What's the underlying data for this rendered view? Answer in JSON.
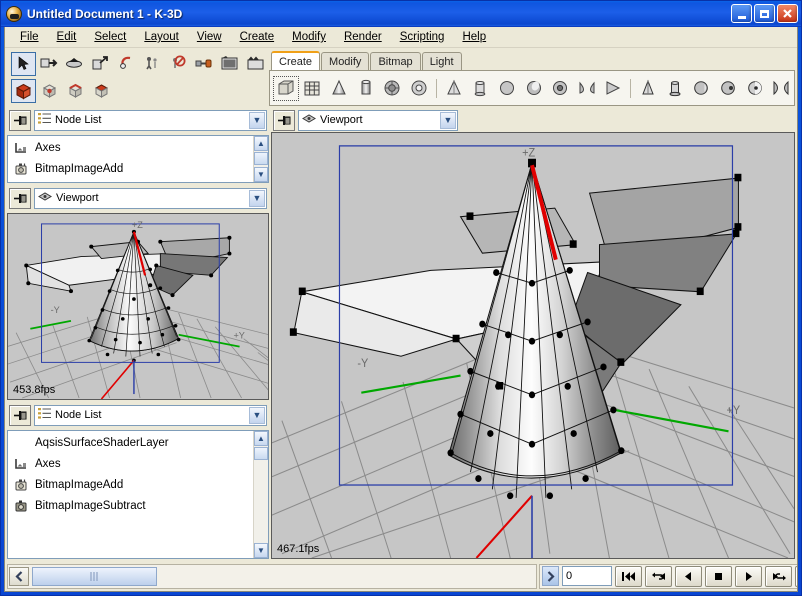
{
  "window": {
    "title": "Untitled Document 1 - K-3D",
    "icon": "k3d-app-icon",
    "buttons": {
      "minimize": "minimize",
      "maximize": "maximize",
      "close": "close"
    }
  },
  "menu": [
    {
      "label": "File",
      "accel": "F"
    },
    {
      "label": "Edit",
      "accel": "E"
    },
    {
      "label": "Select",
      "accel": "S"
    },
    {
      "label": "Layout",
      "accel": "L"
    },
    {
      "label": "View",
      "accel": "V"
    },
    {
      "label": "Create",
      "accel": "C"
    },
    {
      "label": "Modify",
      "accel": "M"
    },
    {
      "label": "Render",
      "accel": "R"
    },
    {
      "label": "Scripting",
      "accel": "p"
    },
    {
      "label": "Help",
      "accel": "H"
    }
  ],
  "toolbar_main": {
    "row1": [
      {
        "name": "select-tool",
        "selected": true
      },
      {
        "name": "move-tool",
        "selected": false
      },
      {
        "name": "rotate-tool",
        "selected": false
      },
      {
        "name": "scale-tool",
        "selected": false
      },
      {
        "name": "snap-tool",
        "selected": false
      },
      {
        "name": "parent-tool",
        "selected": false
      },
      {
        "name": "unparent-tool",
        "selected": false
      },
      {
        "name": "connect-tool",
        "selected": false
      },
      {
        "name": "render-preview-tool",
        "selected": false
      },
      {
        "name": "render-frame-tool",
        "selected": false
      }
    ],
    "row2": [
      {
        "name": "select-nodes-mode",
        "selected": true
      },
      {
        "name": "select-points-mode",
        "selected": false
      },
      {
        "name": "select-lines-mode",
        "selected": false
      },
      {
        "name": "select-faces-mode",
        "selected": false
      }
    ]
  },
  "create_tabs": [
    {
      "label": "Create",
      "active": true
    },
    {
      "label": "Modify",
      "active": false
    },
    {
      "label": "Bitmap",
      "active": false
    },
    {
      "label": "Light",
      "active": false
    }
  ],
  "create_shapes": [
    {
      "name": "cube-shape",
      "selected": true
    },
    {
      "name": "grid-shape",
      "selected": false
    },
    {
      "name": "cone-shape",
      "selected": false
    },
    {
      "name": "cylinder-shape",
      "selected": false
    },
    {
      "name": "sphere-shape",
      "selected": false
    },
    {
      "name": "torus-shape",
      "selected": false
    },
    {
      "name": "separator",
      "selected": false
    },
    {
      "name": "poly-cone-shape",
      "selected": false
    },
    {
      "name": "poly-cylinder-shape",
      "selected": false
    },
    {
      "name": "poly-sphere-shape",
      "selected": false
    },
    {
      "name": "poly-disc-shape",
      "selected": false
    },
    {
      "name": "disk-shape",
      "selected": false
    },
    {
      "name": "paraboloid-shape",
      "selected": false
    },
    {
      "name": "hyperboloid-shape",
      "selected": false
    },
    {
      "name": "separator2",
      "selected": false
    },
    {
      "name": "blobby-cone-shape",
      "selected": false
    },
    {
      "name": "blobby-cylinder-shape",
      "selected": false
    },
    {
      "name": "blobby-sphere-shape",
      "selected": false
    },
    {
      "name": "blobby-torus-shape",
      "selected": false
    },
    {
      "name": "blobby-ellipsoid-shape",
      "selected": false
    },
    {
      "name": "blobby-hyperboloid-shape",
      "selected": false
    }
  ],
  "panels": {
    "node_list_top": {
      "pin": "pin-button",
      "title": "Node List",
      "title_icon": "list-icon",
      "items": [
        {
          "label": "Axes",
          "icon": "axes-icon"
        },
        {
          "label": "BitmapImageAdd",
          "icon": "bitmap-icon"
        }
      ]
    },
    "viewport_small": {
      "pin": "pin-button",
      "title": "Viewport",
      "title_icon": "viewport-icon",
      "fps": "453.8fps",
      "axis_labels": {
        "z": "+Z",
        "y_neg": "-Y",
        "y_pos": "+Y"
      }
    },
    "node_list_bottom": {
      "pin": "pin-button",
      "title": "Node List",
      "title_icon": "list-icon",
      "items": [
        {
          "label": "AqsisSurfaceShaderLayer",
          "icon": "none"
        },
        {
          "label": "Axes",
          "icon": "axes-icon"
        },
        {
          "label": "BitmapImageAdd",
          "icon": "bitmap-icon"
        },
        {
          "label": "BitmapImageSubtract",
          "icon": "bitmap-sub-icon"
        }
      ]
    },
    "viewport_main": {
      "pin": "pin-button",
      "title": "Viewport",
      "title_icon": "viewport-icon",
      "fps": "467.1fps",
      "axis_labels": {
        "z": "+Z",
        "y_neg": "-Y",
        "y_pos": "+Y"
      }
    }
  },
  "bottom": {
    "scroll_left_label": "‹",
    "scroll_thumb_label": "‖‖",
    "forward_label": "›",
    "frame_value": "0",
    "transport": [
      {
        "name": "go-to-start-button",
        "glyph": "start"
      },
      {
        "name": "loop-back-button",
        "glyph": "loopback"
      },
      {
        "name": "step-back-button",
        "glyph": "back"
      },
      {
        "name": "stop-button",
        "glyph": "stop"
      },
      {
        "name": "play-button",
        "glyph": "play"
      },
      {
        "name": "loop-forward-button",
        "glyph": "loopfwd"
      },
      {
        "name": "go-to-end-button",
        "glyph": "end"
      }
    ]
  },
  "colors": {
    "title_blue": "#0f55e0",
    "chrome": "#ece9d8",
    "viewport_bg": "#c6c6c6",
    "frame_blue": "#2b3ea8",
    "axis_green": "#00a800",
    "axis_red": "#e00000",
    "tab_accent": "#f0a017"
  }
}
